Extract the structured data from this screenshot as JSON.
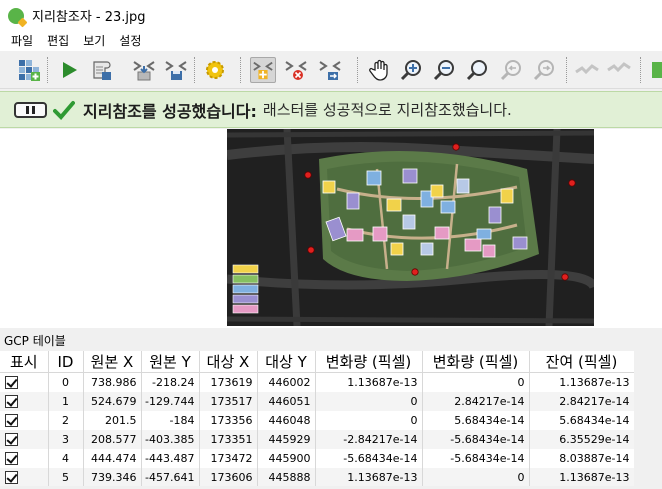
{
  "window": {
    "title": "지리참조자 - 23.jpg"
  },
  "menu": [
    "파일",
    "편집",
    "보기",
    "설정"
  ],
  "toolbar": {
    "icons": [
      "open-raster-icon",
      "start-georeferencing-icon",
      "generate-gdal-script-icon",
      "load-gcp-points-icon",
      "save-gcp-points-icon",
      "transformation-settings-icon",
      "add-point-icon",
      "delete-point-icon",
      "move-gcp-point-icon",
      "pan-icon",
      "zoom-in-icon",
      "zoom-out-icon",
      "zoom-to-layer-icon",
      "zoom-last-icon",
      "zoom-next-icon",
      "link-georeferencer-to-qgis-icon",
      "link-qgis-to-georeferencer-icon",
      "full-histogram-stretch-icon"
    ]
  },
  "message": {
    "title": "지리참조를 성공했습니다:",
    "text": "래스터를 성공적으로 지리참조했습니다."
  },
  "gcp_panel": {
    "title": "GCP 테이블",
    "columns": [
      "표시",
      "ID",
      "원본 X",
      "원본 Y",
      "대상 X",
      "대상 Y",
      "변화량 (픽셀)",
      "변화량 (픽셀)",
      "잔여 (픽셀)"
    ],
    "rows": [
      {
        "enabled": true,
        "id": "0",
        "src_x": "738.986",
        "src_y": "-218.24",
        "dst_x": "173619",
        "dst_y": "446002",
        "dx": "1.13687e-13",
        "dy": "0",
        "residual": "1.13687e-13"
      },
      {
        "enabled": true,
        "id": "1",
        "src_x": "524.679",
        "src_y": "-129.744",
        "dst_x": "173517",
        "dst_y": "446051",
        "dx": "0",
        "dy": "2.84217e-14",
        "residual": "2.84217e-14"
      },
      {
        "enabled": true,
        "id": "2",
        "src_x": "201.5",
        "src_y": "-184",
        "dst_x": "173356",
        "dst_y": "446048",
        "dx": "0",
        "dy": "5.68434e-14",
        "residual": "5.68434e-14"
      },
      {
        "enabled": true,
        "id": "3",
        "src_x": "208.577",
        "src_y": "-403.385",
        "dst_x": "173351",
        "dst_y": "445929",
        "dx": "-2.84217e-14",
        "dy": "-5.68434e-14",
        "residual": "6.35529e-14"
      },
      {
        "enabled": true,
        "id": "4",
        "src_x": "444.474",
        "src_y": "-443.487",
        "dst_x": "173472",
        "dst_y": "445900",
        "dx": "-5.68434e-14",
        "dy": "-5.68434e-14",
        "residual": "8.03887e-14"
      },
      {
        "enabled": true,
        "id": "5",
        "src_x": "739.346",
        "src_y": "-457.641",
        "dst_x": "173606",
        "dst_y": "445888",
        "dx": "1.13687e-13",
        "dy": "0",
        "residual": "1.13687e-13"
      }
    ]
  },
  "colors": {
    "message_bg": "#e1f0d6",
    "success_green": "#2f9a33",
    "gcp_red": "#e0201e"
  }
}
